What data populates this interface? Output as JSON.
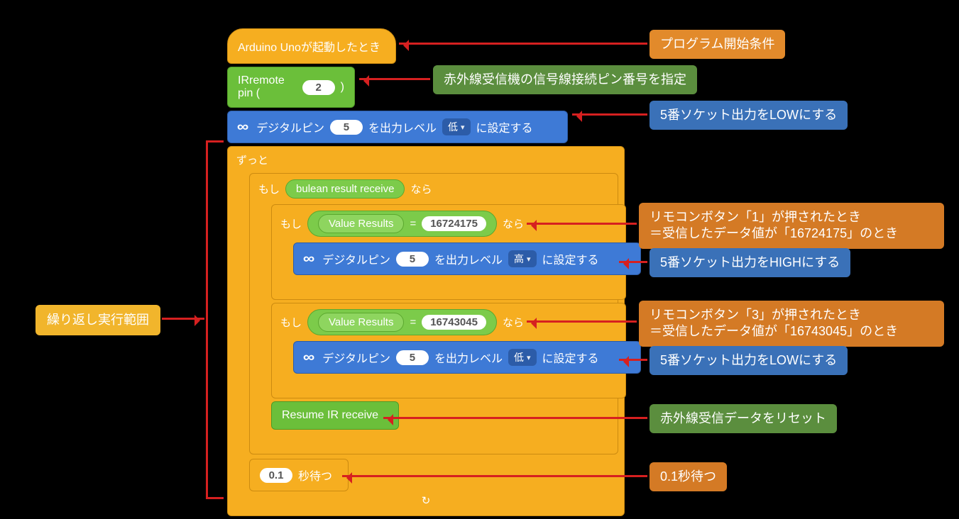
{
  "event": {
    "label": "Arduino Unoが起動したとき"
  },
  "ir_pin": {
    "prefix": "IRremote pin (",
    "value": "2",
    "suffix": ")"
  },
  "dp_init": {
    "t1": "デジタルピン",
    "pin": "5",
    "t2": "を出力レベル",
    "level": "低",
    "t3": "に設定する"
  },
  "forever": {
    "label": "ずっと"
  },
  "if_recv": {
    "if": "もし",
    "cond": "bulean result receive",
    "then": "なら"
  },
  "if_val1": {
    "if": "もし",
    "lhs": "Value Results",
    "eq": "=",
    "rhs": "16724175",
    "then": "なら"
  },
  "dp_high": {
    "t1": "デジタルピン",
    "pin": "5",
    "t2": "を出力レベル",
    "level": "高",
    "t3": "に設定する"
  },
  "if_val2": {
    "if": "もし",
    "lhs": "Value Results",
    "eq": "=",
    "rhs": "16743045",
    "then": "なら"
  },
  "dp_low2": {
    "t1": "デジタルピン",
    "pin": "5",
    "t2": "を出力レベル",
    "level": "低",
    "t3": "に設定する"
  },
  "resume": {
    "label": "Resume IR receive"
  },
  "wait": {
    "value": "0.1",
    "label": "秒待つ"
  },
  "anno": {
    "start": "プログラム開始条件",
    "irpin": "赤外線受信機の信号線接続ピン番号を指定",
    "dp_init": "5番ソケット出力をLOWにする",
    "looprange": "繰り返し実行範囲",
    "val1_l1": "リモコンボタン「1」が押されたとき",
    "val1_l2": "＝受信したデータ値が「16724175」のとき",
    "dp_high": "5番ソケット出力をHIGHにする",
    "val2_l1": "リモコンボタン「3」が押されたとき",
    "val2_l2": "＝受信したデータ値が「16743045」のとき",
    "dp_low2": "5番ソケット出力をLOWにする",
    "resume": "赤外線受信データをリセット",
    "wait": "0.1秒待つ"
  }
}
